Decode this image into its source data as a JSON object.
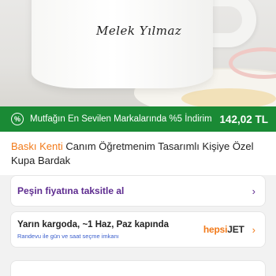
{
  "product_image": {
    "mug_text": "Melek Yılmaz"
  },
  "campaign": {
    "icon": "percent-badge-icon",
    "text": "Mutfağın En Sevilen Markalarında %5 İndirim",
    "price": "142,02 TL",
    "color": "#1a8a35"
  },
  "product": {
    "brand": "Baskı Kenti",
    "title": "Canım Öğretmenim  Tasarımlı Kişiye Özel Kupa Bardak"
  },
  "installment": {
    "label": "Peşin fiyatına taksitle al",
    "color": "#5d2b8f"
  },
  "shipping": {
    "title": "Yarın kargoda, ~1 Haz, Paz kapında",
    "subtitle": "Randevu ile gün ve saat seçme imkanı",
    "carrier_prefix": "hepsi",
    "carrier_suffix": "JET"
  }
}
